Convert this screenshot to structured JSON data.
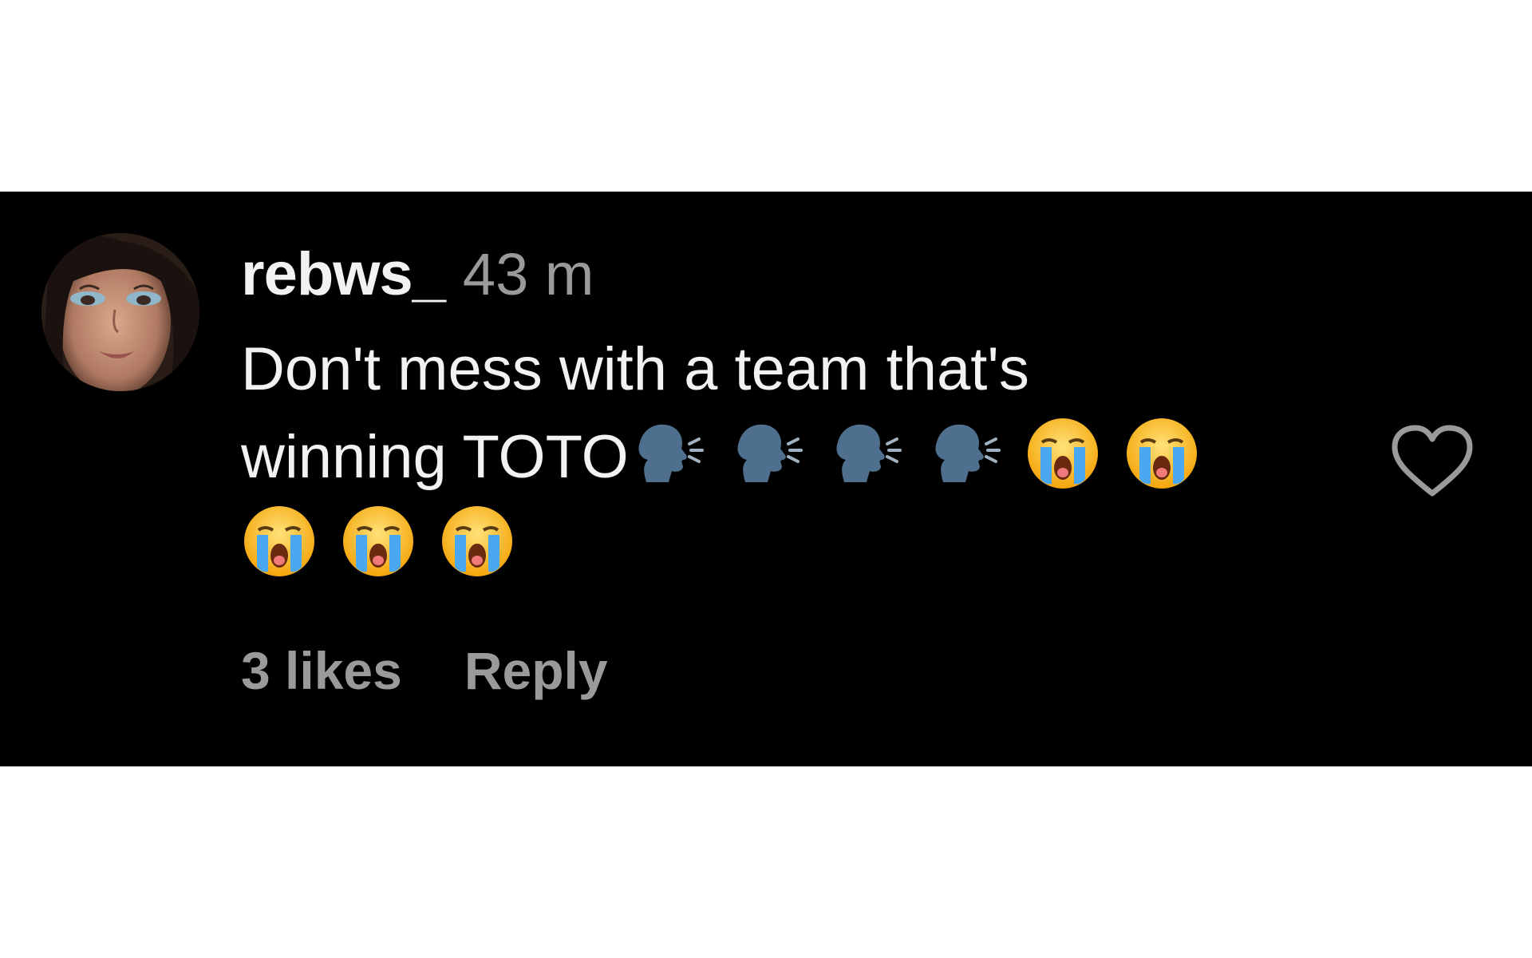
{
  "comment": {
    "username": "rebws_",
    "timestamp": "43 m",
    "text_line1": "Don't mess with a team that's",
    "text_line2": "winning TOTO",
    "emojis": [
      "speaking-head-icon",
      "speaking-head-icon",
      "speaking-head-icon",
      "speaking-head-icon",
      "loudly-crying-face-icon",
      "loudly-crying-face-icon",
      "loudly-crying-face-icon",
      "loudly-crying-face-icon",
      "loudly-crying-face-icon"
    ],
    "likes": "3 likes",
    "reply_label": "Reply",
    "avatar": "avatar-photo",
    "like_icon": "heart-outline-icon"
  },
  "colors": {
    "band_background": "#000000",
    "page_background": "#ffffff",
    "text_primary": "#f2f2f2",
    "text_secondary": "#9a9a9a"
  }
}
